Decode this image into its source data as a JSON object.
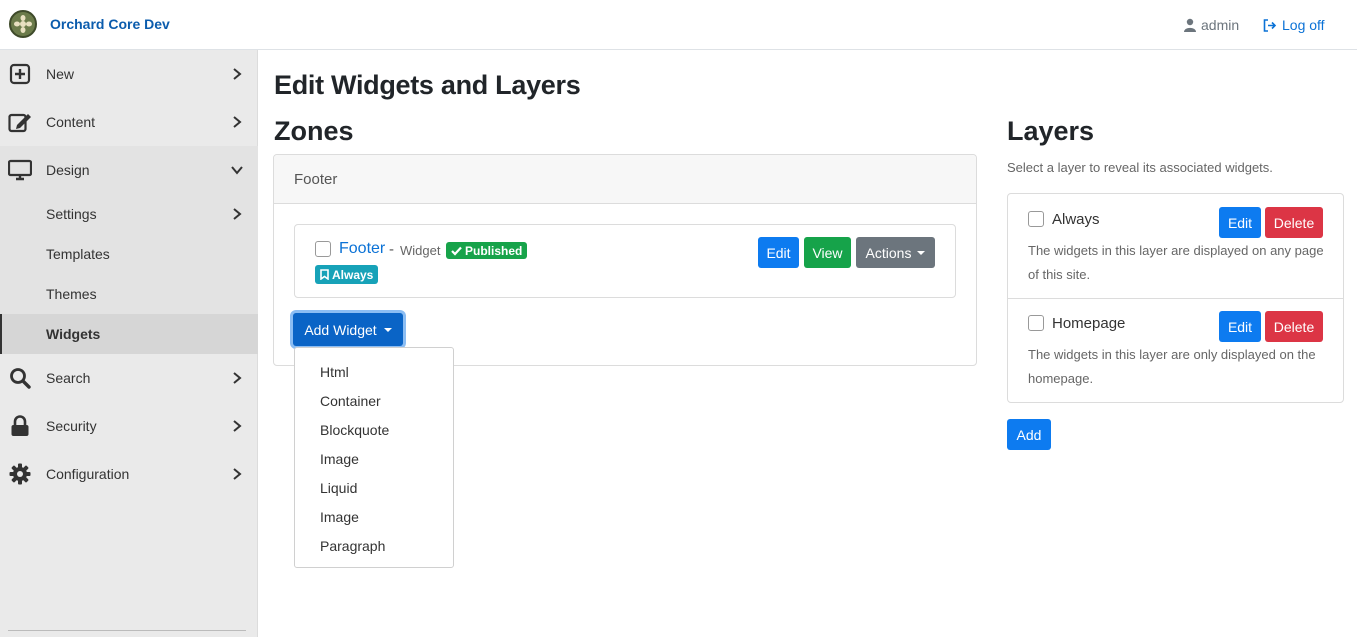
{
  "header": {
    "brand": "Orchard Core Dev",
    "user": "admin",
    "logoff": "Log off"
  },
  "sidebar": {
    "items": [
      {
        "label": "New",
        "icon": "plus-square-icon"
      },
      {
        "label": "Content",
        "icon": "edit-icon"
      },
      {
        "label": "Design",
        "icon": "desktop-icon"
      },
      {
        "label": "Search",
        "icon": "search-icon"
      },
      {
        "label": "Security",
        "icon": "lock-icon"
      },
      {
        "label": "Configuration",
        "icon": "gear-icon"
      }
    ],
    "design_children": [
      {
        "label": "Settings"
      },
      {
        "label": "Templates"
      },
      {
        "label": "Themes"
      },
      {
        "label": "Widgets",
        "active": true
      }
    ]
  },
  "main": {
    "title": "Edit Widgets and Layers",
    "zones_heading": "Zones",
    "zone": {
      "name": "Footer",
      "widget": {
        "title": "Footer",
        "dash": "-",
        "type": "Widget",
        "status": "Published",
        "layer": "Always",
        "edit": "Edit",
        "view": "View",
        "actions": "Actions"
      },
      "add_widget": "Add Widget",
      "add_widget_options": [
        "Html",
        "Container",
        "Blockquote",
        "Image",
        "Liquid",
        "Image",
        "Paragraph"
      ]
    },
    "layers_heading": "Layers",
    "layers_hint": "Select a layer to reveal its associated widgets.",
    "layers": [
      {
        "name": "Always",
        "desc_line1": "The widgets in this layer are displayed on any page",
        "desc_line2": "of this site.",
        "edit": "Edit",
        "delete": "Delete"
      },
      {
        "name": "Homepage",
        "desc_line1": "The widgets in this layer are only displayed on the",
        "desc_line2": "homepage.",
        "edit": "Edit",
        "delete": "Delete"
      }
    ],
    "layers_add": "Add"
  },
  "colors": {
    "primary": "#0d7bf0",
    "success": "#16a34a",
    "danger": "#dc3545",
    "info": "#17a2b8",
    "secondary": "#6c757d"
  }
}
